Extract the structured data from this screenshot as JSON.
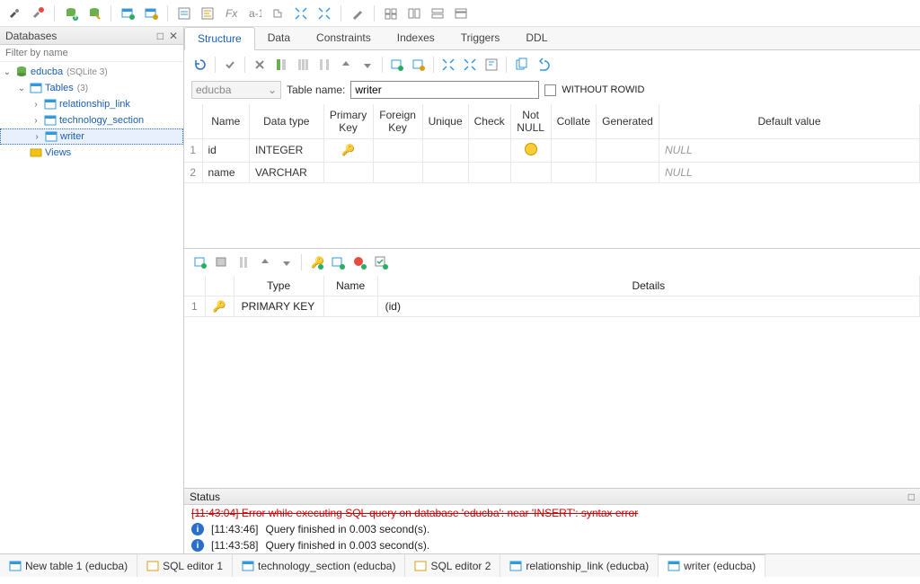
{
  "leftPanel": {
    "title": "Databases",
    "filterPlaceholder": "Filter by name",
    "db": {
      "name": "educba",
      "engine": "(SQLite 3)"
    },
    "tablesLabel": "Tables",
    "tablesCount": "(3)",
    "tables": [
      "relationship_link",
      "technology_section",
      "writer"
    ],
    "viewsLabel": "Views"
  },
  "tabs": [
    "Structure",
    "Data",
    "Constraints",
    "Indexes",
    "Triggers",
    "DDL"
  ],
  "tableNameBar": {
    "dbSelected": "educba",
    "label": "Table name:",
    "value": "writer",
    "withoutRowid": "WITHOUT ROWID"
  },
  "columnsHeaders": [
    "Name",
    "Data type",
    "Primary Key",
    "Foreign Key",
    "Unique",
    "Check",
    "Not NULL",
    "Collate",
    "Generated",
    "Default value"
  ],
  "columns": [
    {
      "n": "1",
      "name": "id",
      "type": "INTEGER",
      "pk": true,
      "notnull": true,
      "default": "NULL"
    },
    {
      "n": "2",
      "name": "name",
      "type": "VARCHAR",
      "pk": false,
      "notnull": false,
      "default": "NULL"
    }
  ],
  "constraintsHeaders": [
    "Type",
    "Name",
    "Details"
  ],
  "constraints": [
    {
      "n": "1",
      "type": "PRIMARY KEY",
      "name": "",
      "details": "(id)"
    }
  ],
  "statusTitle": "Status",
  "statusRows": [
    {
      "kind": "error",
      "text": "[11:43:04]  Error while executing SQL query on database 'educba': near 'INSERT': syntax error"
    },
    {
      "kind": "info",
      "time": "[11:43:46]",
      "text": "Query finished in 0.003 second(s)."
    },
    {
      "kind": "info",
      "time": "[11:43:58]",
      "text": "Query finished in 0.003 second(s)."
    }
  ],
  "bottomTabs": [
    "New table 1 (educba)",
    "SQL editor 1",
    "technology_section (educba)",
    "SQL editor 2",
    "relationship_link (educba)",
    "writer (educba)"
  ]
}
